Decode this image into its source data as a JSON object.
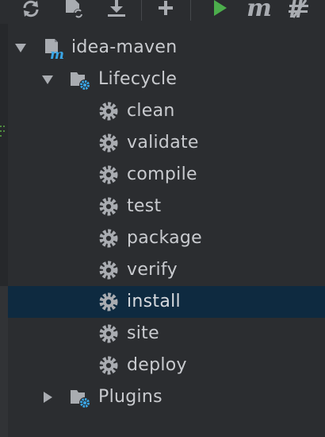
{
  "toolbar": {
    "buttons": [
      {
        "name": "reimport-icon"
      },
      {
        "name": "generate-sources-icon"
      },
      {
        "name": "download-icon"
      },
      {
        "name": "add-icon"
      },
      {
        "name": "run-icon"
      },
      {
        "name": "maven-goal-icon"
      },
      {
        "name": "toggle-offline-icon"
      }
    ],
    "maven_glyph": "m"
  },
  "tree": {
    "project": {
      "label": "idea-maven",
      "expanded": true,
      "badge": "m"
    },
    "lifecycle": {
      "label": "Lifecycle",
      "expanded": true,
      "goals": [
        {
          "label": "clean"
        },
        {
          "label": "validate"
        },
        {
          "label": "compile"
        },
        {
          "label": "test"
        },
        {
          "label": "package"
        },
        {
          "label": "verify"
        },
        {
          "label": "install",
          "selected": true
        },
        {
          "label": "site"
        },
        {
          "label": "deploy"
        }
      ]
    },
    "plugins": {
      "label": "Plugins",
      "expanded": false
    }
  },
  "colors": {
    "background": "#2b2d30",
    "selection": "#0e2a40",
    "text": "#c9cbcf",
    "icon_gray": "#a9acb1",
    "accent_blue": "#3aa6e6",
    "run_green": "#4cae4c"
  }
}
